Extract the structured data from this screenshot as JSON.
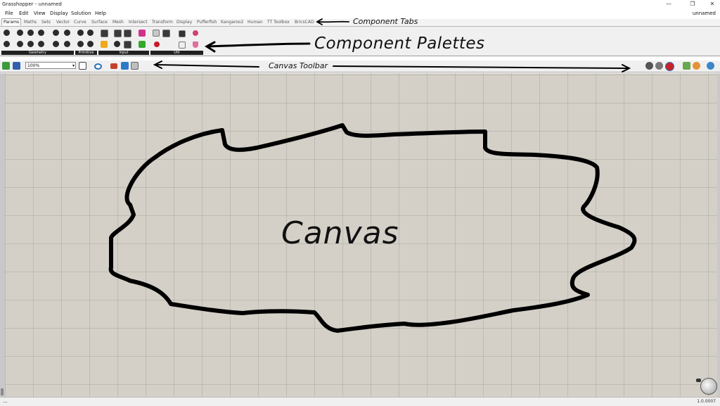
{
  "window": {
    "title": "Grasshopper - unnamed",
    "minimize_glyph": "—",
    "restore_glyph": "❐",
    "close_glyph": "✕"
  },
  "menu": {
    "items": [
      "File",
      "Edit",
      "View",
      "Display",
      "Solution",
      "Help"
    ],
    "document_name": "unnamed"
  },
  "tabs": [
    "Params",
    "Maths",
    "Sets",
    "Vector",
    "Curve",
    "Surface",
    "Mesh",
    "Intersect",
    "Transform",
    "Display",
    "Pufferfish",
    "Kangaroo2",
    "Human",
    "TT Toolbox",
    "BricsCAD"
  ],
  "palettes": {
    "groups": [
      "Geometry",
      "Primitive",
      "Input",
      "Util"
    ]
  },
  "toolbar": {
    "zoom_value": "100%",
    "zoom_arrow": "▾"
  },
  "status": {
    "left_text": "...",
    "version": "1.0.0007"
  },
  "annotations": {
    "component_tabs": "Component Tabs",
    "component_palettes": "Component Palettes",
    "canvas_toolbar": "Canvas Toolbar",
    "canvas": "Canvas"
  },
  "colors": {
    "canvas_bg": "#d4d0c8",
    "palette_label_bg": "#202020",
    "annotation_ink": "#000000"
  }
}
